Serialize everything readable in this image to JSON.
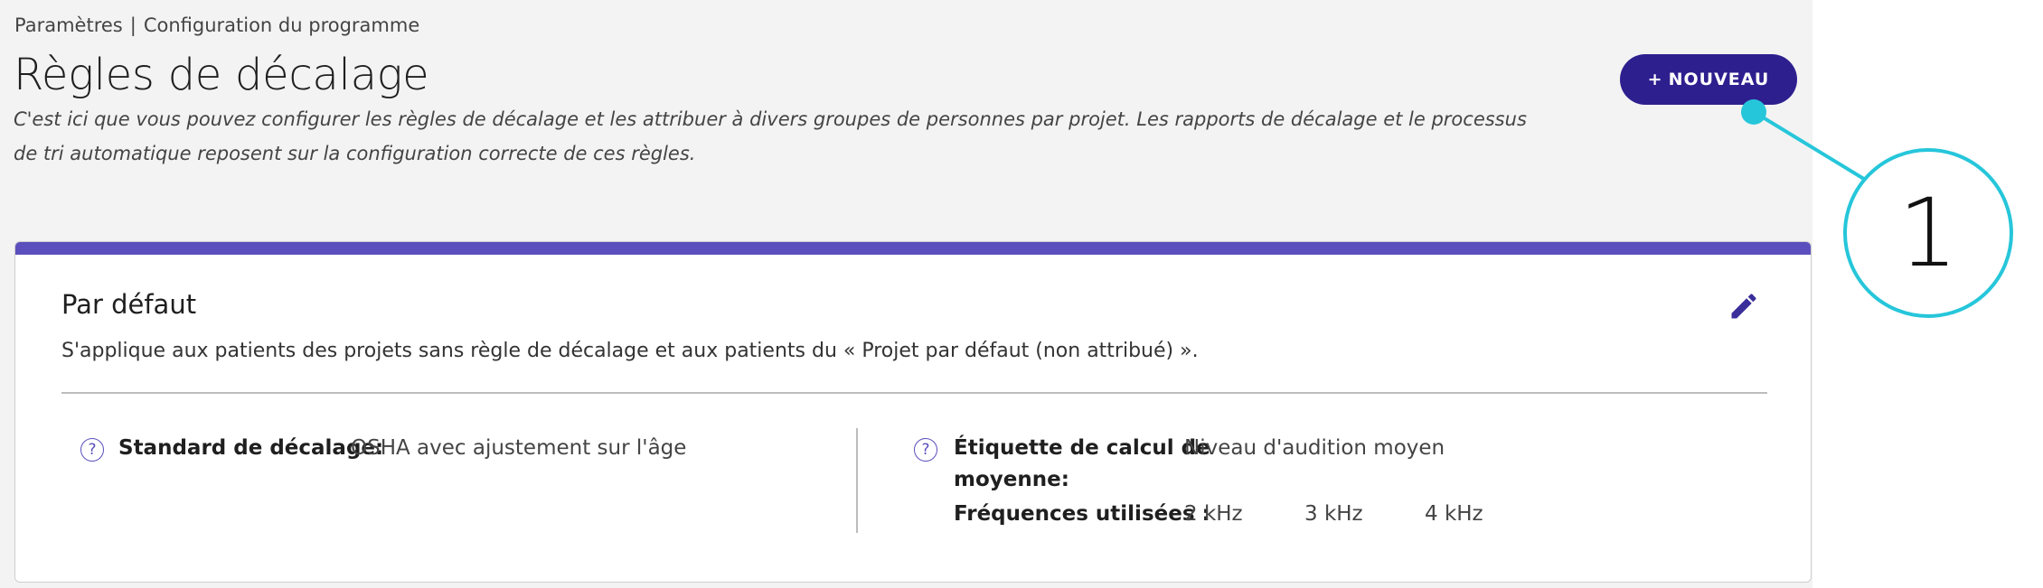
{
  "breadcrumb": {
    "parent": "Paramètres",
    "separator": "|",
    "current": "Configuration du programme"
  },
  "page": {
    "title": "Règles de décalage",
    "description": "C'est ici que vous pouvez configurer les règles de décalage et les attribuer à divers groupes de personnes par projet. Les rapports de décalage et le processus de tri automatique reposent sur la configuration correcte de ces règles."
  },
  "toolbar": {
    "new_button_icon": "+",
    "new_button_label": "NOUVEAU"
  },
  "callout": {
    "number": "1",
    "color": "#26c6da"
  },
  "rule_card": {
    "title": "Par défaut",
    "description": "S'applique aux patients des projets sans règle de décalage et aux patients du « Projet par défaut (non attribué) ».",
    "accent_color": "#5b4fbd",
    "edit_icon": "pencil-icon",
    "standard": {
      "help_icon": "?",
      "label": "Standard de décalage:",
      "value": "OSHA avec ajustement sur l'âge"
    },
    "averaging": {
      "help_icon": "?",
      "label_line1": "Étiquette de calcul de",
      "label_line2": "moyenne:",
      "value": "Niveau d'audition moyen"
    },
    "frequencies": {
      "label": "Fréquences utilisées :",
      "values": [
        "2 kHz",
        "3 kHz",
        "4 kHz"
      ]
    }
  }
}
